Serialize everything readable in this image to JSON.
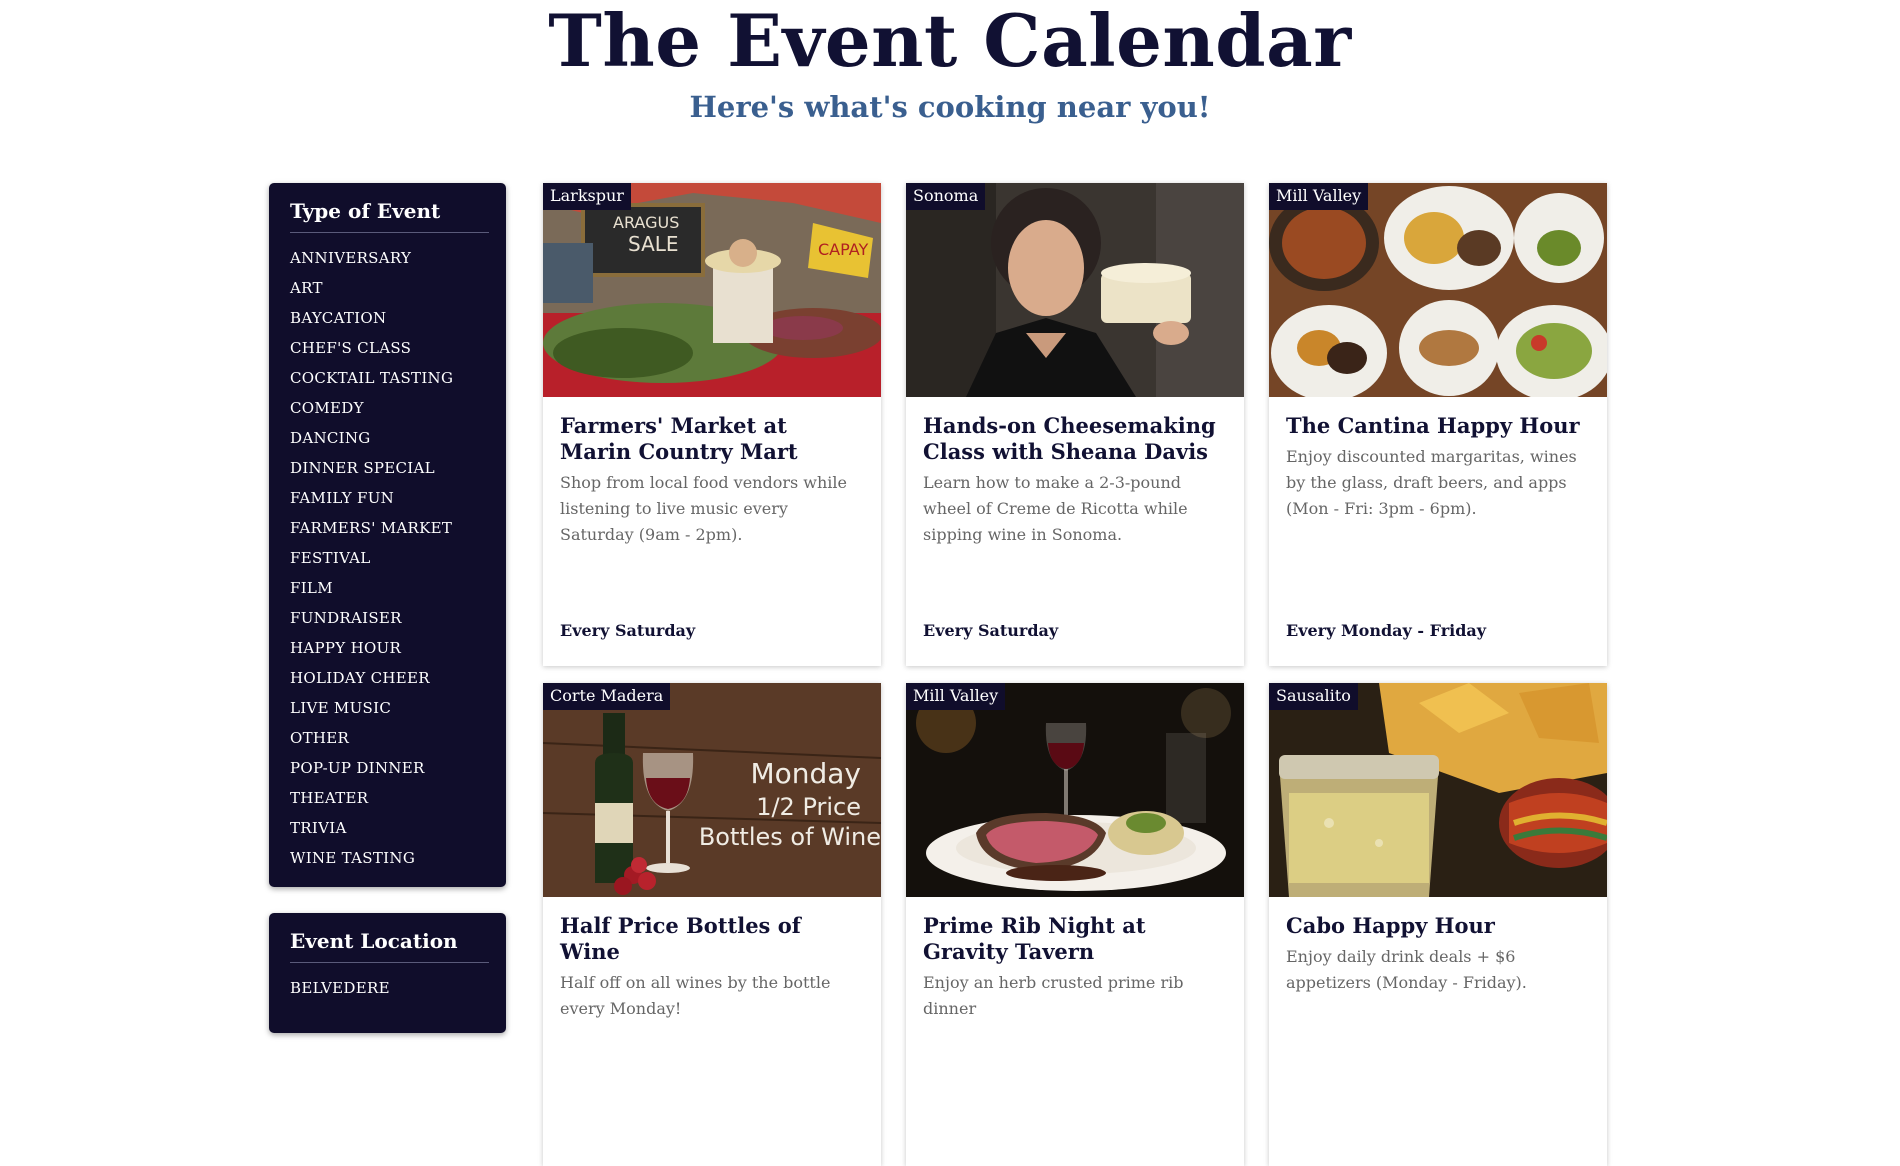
{
  "header": {
    "title": "The Event Calendar",
    "subtitle": "Here's what's cooking near you!"
  },
  "sidebar": {
    "type_heading": "Type of Event",
    "type_items": [
      "ANNIVERSARY",
      "ART",
      "BAYCATION",
      "CHEF'S CLASS",
      "COCKTAIL TASTING",
      "COMEDY",
      "DANCING",
      "DINNER SPECIAL",
      "FAMILY FUN",
      "FARMERS' MARKET",
      "FESTIVAL",
      "FILM",
      "FUNDRAISER",
      "HAPPY HOUR",
      "HOLIDAY CHEER",
      "LIVE MUSIC",
      "OTHER",
      "POP-UP DINNER",
      "THEATER",
      "TRIVIA",
      "WINE TASTING"
    ],
    "location_heading": "Event Location",
    "location_items": [
      "BELVEDERE"
    ]
  },
  "events": [
    {
      "location": "Larkspur",
      "title": "Farmers' Market at Marin Country Mart",
      "description": "Shop from local food vendors while listening to live music every Saturday (9am - 2pm).",
      "when": "Every Saturday",
      "image": "farmers-market-photo",
      "photo_text": [
        "ARAGUS",
        "SALE",
        "CAPAY"
      ]
    },
    {
      "location": "Sonoma",
      "title": "Hands-on Cheesemaking Class with Sheana Davis",
      "description": "Learn how to make a 2-3-pound wheel of Creme de Ricotta while sipping wine in Sonoma.",
      "when": "Every Saturday",
      "image": "cheesemaker-photo"
    },
    {
      "location": "Mill Valley",
      "title": "The Cantina Happy Hour",
      "description": "Enjoy discounted margaritas, wines by the glass, draft beers, and apps (Mon - Fri: 3pm - 6pm).",
      "when": "Every Monday - Friday",
      "image": "mexican-food-photo"
    },
    {
      "location": "Corte Madera",
      "title": "Half Price Bottles of Wine",
      "description": "Half off on all wines by the bottle every Monday!",
      "when": "",
      "image": "wine-bottle-photo",
      "photo_text": [
        "Monday",
        "1/2 Price",
        "Bottles of Wine"
      ]
    },
    {
      "location": "Mill Valley",
      "title": "Prime Rib Night at Gravity Tavern",
      "description": "Enjoy an herb crusted prime rib dinner",
      "when": "",
      "image": "prime-rib-photo"
    },
    {
      "location": "Sausalito",
      "title": "Cabo Happy Hour",
      "description": "Enjoy daily drink deals + $6 appetizers (Monday - Friday).",
      "when": "",
      "image": "margarita-photo"
    }
  ],
  "colors": {
    "panel_bg": "#100d2b",
    "title_color": "#111133",
    "subtitle_color": "#3a5f8f"
  }
}
